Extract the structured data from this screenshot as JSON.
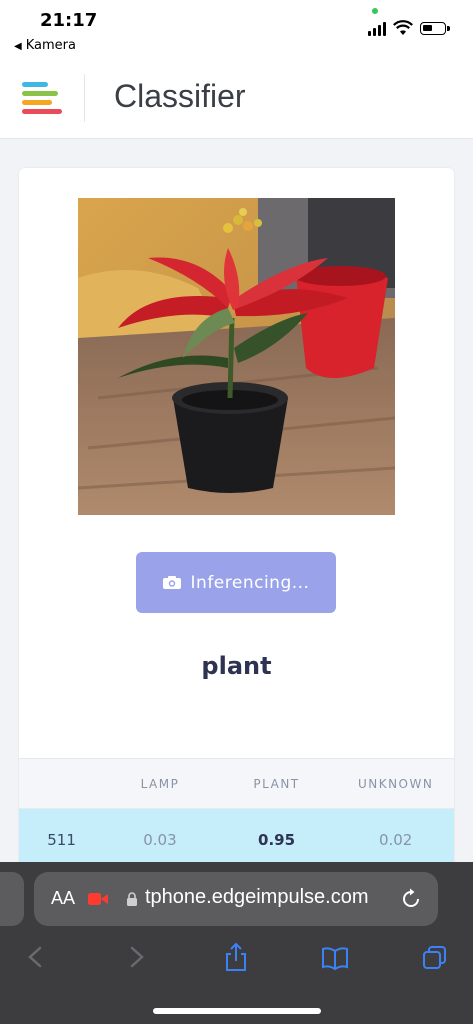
{
  "status_bar": {
    "time": "21:17",
    "back_label": "Kamera"
  },
  "header": {
    "title": "Classifier"
  },
  "button": {
    "label": "Inferencing..."
  },
  "result": {
    "label": "plant"
  },
  "table": {
    "columns": [
      "",
      "LAMP",
      "PLANT",
      "UNKNOWN"
    ],
    "rows": [
      {
        "id": "511",
        "lamp": "0.03",
        "plant": "0.95",
        "unknown": "0.02"
      }
    ]
  },
  "browser": {
    "url": "tphone.edgeimpulse.com",
    "text_size_label": "AA"
  },
  "colors": {
    "button": "#9aa3ea",
    "row_highlight": "#c5eefa",
    "accent_green": "#34c759"
  }
}
